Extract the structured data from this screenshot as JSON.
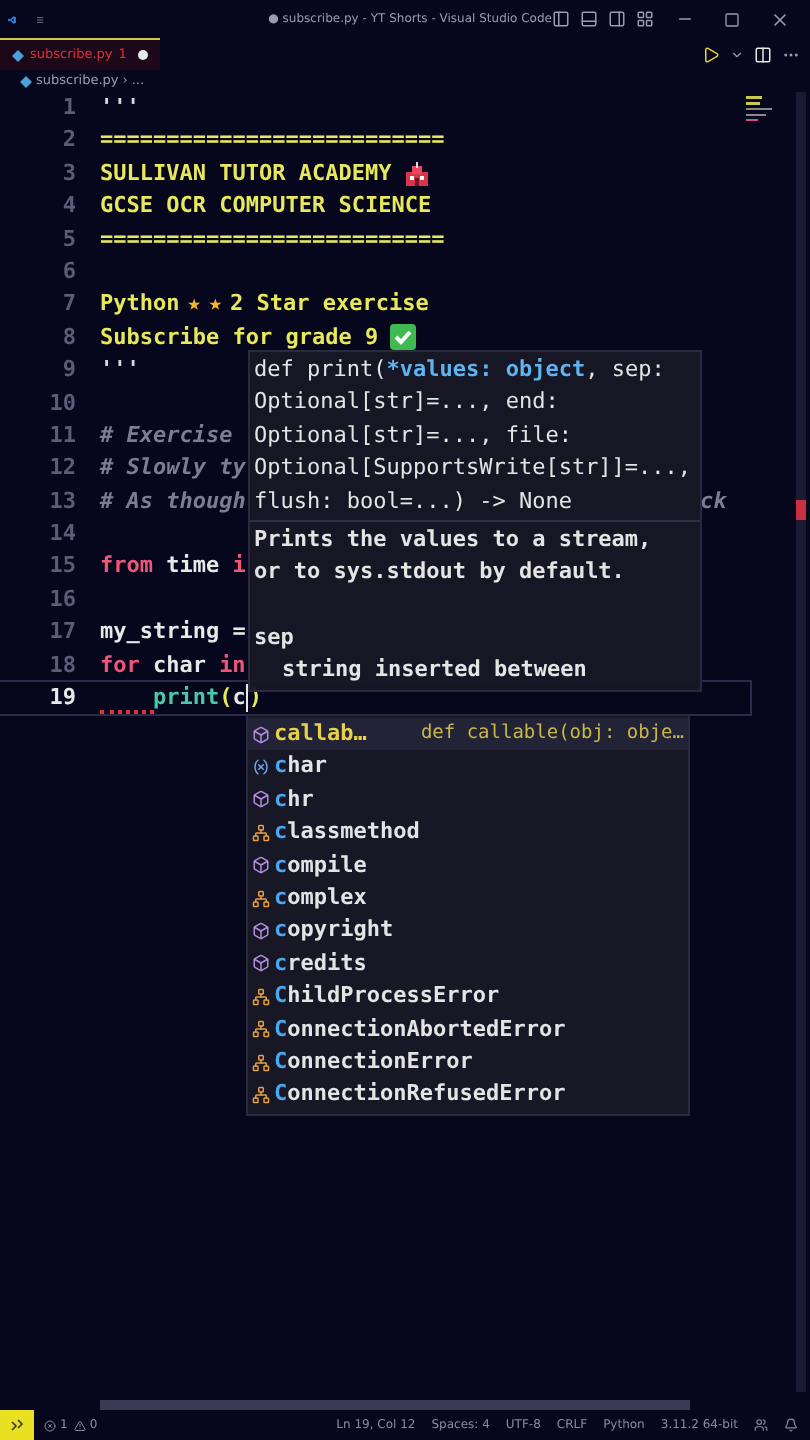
{
  "window": {
    "title": "● subscribe.py - YT Shorts - Visual Studio Code"
  },
  "tab": {
    "label": "subscribe.py",
    "problems": "1",
    "modified": true,
    "selected": true
  },
  "breadcrumb": [
    "subscribe.py",
    "›",
    "..."
  ],
  "editor": {
    "lines": [
      {
        "number": "1",
        "tokens": [
          {
            "t": "'''",
            "kind": "docstring"
          }
        ]
      },
      {
        "number": "2",
        "tokens": [
          {
            "t": "==========================",
            "kind": "text"
          }
        ]
      },
      {
        "number": "3",
        "tokens": [
          {
            "t": "SULLIVAN TUTOR ACADEMY",
            "kind": "text"
          },
          {
            "kind": "school"
          }
        ]
      },
      {
        "number": "4",
        "tokens": [
          {
            "t": "GCSE OCR COMPUTER SCIENCE",
            "kind": "text"
          }
        ]
      },
      {
        "number": "5",
        "tokens": [
          {
            "t": "==========================",
            "kind": "text"
          }
        ]
      },
      {
        "number": "6"
      },
      {
        "number": "7",
        "tokens": [
          {
            "t": "Python",
            "kind": "text"
          },
          {
            "t": "★",
            "kind": "star"
          },
          {
            "t": "★",
            "kind": "star"
          },
          {
            "t": "2 Star exercise",
            "kind": "text"
          }
        ]
      },
      {
        "number": "8",
        "tokens": [
          {
            "t": "Subscribe for grade 9",
            "kind": "text"
          },
          {
            "kind": "check"
          }
        ]
      },
      {
        "number": "9",
        "tokens": [
          {
            "t": "'''",
            "kind": "docstring"
          }
        ]
      },
      {
        "number": "10"
      },
      {
        "number": "11",
        "tokens": [
          {
            "t": "# Exercise",
            "kind": "comment"
          }
        ]
      },
      {
        "number": "12",
        "tokens": [
          {
            "t": "# Slowly ty",
            "kind": "comment"
          }
        ]
      },
      {
        "number": "13",
        "tokens": [
          {
            "t": "# As though",
            "kind": "comment"
          }
        ],
        "tail": "ck"
      },
      {
        "number": "14"
      },
      {
        "number": "15",
        "tokens": [
          {
            "t": "from",
            "kind": "keyword"
          },
          {
            "t": "time",
            "kind": "name"
          },
          {
            "t": "i",
            "kind": "keyword"
          }
        ]
      },
      {
        "number": "16"
      },
      {
        "number": "17",
        "tokens": [
          {
            "t": "my_string =",
            "kind": "name"
          }
        ]
      },
      {
        "number": "18",
        "tokens": [
          {
            "t": "for",
            "kind": "keyword"
          },
          {
            "t": "char",
            "kind": "name"
          },
          {
            "t": "in",
            "kind": "keyword"
          }
        ]
      },
      {
        "number": "19",
        "current": true,
        "error": true,
        "tokens": [
          {
            "t": "    print",
            "kind": "call"
          },
          {
            "t": "(",
            "kind": "paren"
          },
          {
            "t": "c",
            "kind": "name"
          },
          {
            "kind": "cursor"
          },
          {
            "t": ")",
            "kind": "paren"
          }
        ]
      }
    ]
  },
  "hover": {
    "signature": [
      [
        {
          "t": "def print(",
          "kind": "plain"
        },
        {
          "t": "*values: object",
          "kind": "param"
        },
        {
          "t": ", sep:",
          "kind": "plain"
        }
      ],
      [
        {
          "t": "Optional[str]=..., end:",
          "kind": "plain"
        }
      ],
      [
        {
          "t": "Optional[str]=..., file:",
          "kind": "plain"
        }
      ],
      [
        {
          "t": "Optional[SupportsWrite[str]]=...,",
          "kind": "plain"
        }
      ],
      [
        {
          "t": "flush: bool=...) -> None",
          "kind": "plain"
        }
      ]
    ],
    "doc": [
      "Prints the values to a stream,",
      "or to sys.stdout by default."
    ],
    "param": {
      "name": "sep",
      "description": "string inserted between"
    }
  },
  "suggestions": [
    {
      "label": "callab…",
      "kind": "function",
      "selected": true,
      "detail": "def callable(obj: obje…"
    },
    {
      "label": "char",
      "kind": "variable",
      "selected": false
    },
    {
      "label": "chr",
      "kind": "function",
      "selected": false
    },
    {
      "label": "classmethod",
      "kind": "class",
      "selected": false
    },
    {
      "label": "compile",
      "kind": "function",
      "selected": false
    },
    {
      "label": "complex",
      "kind": "class",
      "selected": false
    },
    {
      "label": "copyright",
      "kind": "function",
      "selected": false
    },
    {
      "label": "credits",
      "kind": "function",
      "selected": false
    },
    {
      "label": "ChildProcessError",
      "kind": "class",
      "selected": false
    },
    {
      "label": "ConnectionAbortedError",
      "kind": "class",
      "selected": false
    },
    {
      "label": "ConnectionError",
      "kind": "class",
      "selected": false
    },
    {
      "label": "ConnectionRefusedError",
      "kind": "class",
      "selected": false
    }
  ],
  "status_bar": {
    "errors": "1",
    "warnings": "0",
    "items": [
      "Ln 19, Col 12",
      "Spaces: 4",
      "UTF-8",
      "CRLF",
      "Python",
      "3.11.2 64-bit"
    ]
  }
}
